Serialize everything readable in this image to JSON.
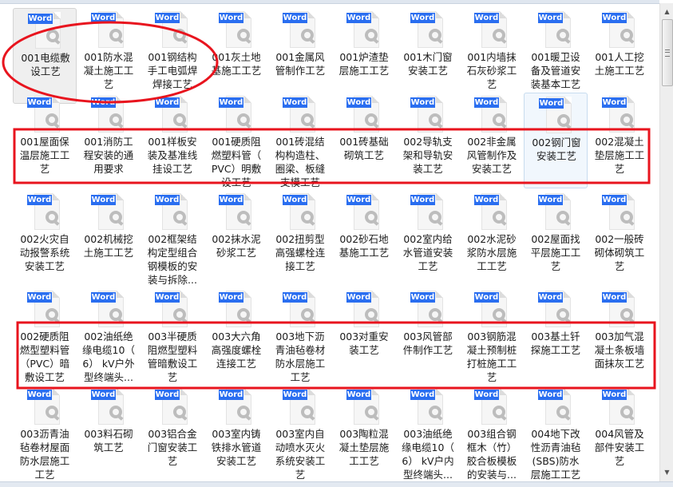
{
  "badge_label": "Word",
  "icon": "wps-word-document-icon",
  "colors": {
    "badge": "#2a6ef0",
    "annotation": "#e8141e",
    "selected": "#efefef",
    "hover": "#f1f7fd"
  },
  "files": [
    {
      "name": "001电缆敷设工艺",
      "state": "selected"
    },
    {
      "name": "001防水混凝土施工工艺"
    },
    {
      "name": "001钢结构手工电弧焊焊接工艺"
    },
    {
      "name": "001灰土地基施工工艺"
    },
    {
      "name": "001金属风管制作工艺"
    },
    {
      "name": "001炉渣垫层施工工艺"
    },
    {
      "name": "001木门窗安装工艺"
    },
    {
      "name": "001内墙抹石灰砂浆工艺"
    },
    {
      "name": "001暖卫设备及管道安装基本工艺"
    },
    {
      "name": "001人工挖土施工工艺"
    },
    {
      "name": "001屋面保温层施工工艺"
    },
    {
      "name": "001消防工程安装的通用要求"
    },
    {
      "name": "001样板安装及基准线挂设工艺"
    },
    {
      "name": "001硬质阻燃塑料管（PVC）明敷设工艺"
    },
    {
      "name": "001砖混结构构造柱、圈梁、板缝支模工艺"
    },
    {
      "name": "001砖基础砌筑工艺"
    },
    {
      "name": "002导轨支架和导轨安装工艺"
    },
    {
      "name": "002非金属风管制作及安装工艺"
    },
    {
      "name": "002钢门窗安装工艺",
      "state": "hover"
    },
    {
      "name": "002混凝土垫层施工工艺"
    },
    {
      "name": "002火灾自动报警系统安装工艺"
    },
    {
      "name": "002机械挖土施工工艺"
    },
    {
      "name": "002框架结构定型组合钢模板的安装与拆除..."
    },
    {
      "name": "002抹水泥砂浆工艺"
    },
    {
      "name": "002扭剪型高强螺栓连接工艺"
    },
    {
      "name": "002砂石地基施工工艺"
    },
    {
      "name": "002室内给水管道安装工艺"
    },
    {
      "name": "002水泥砂浆防水层施工工艺"
    },
    {
      "name": "002屋面找平层施工工艺"
    },
    {
      "name": "002一般砖砌体砌筑工艺"
    },
    {
      "name": "002硬质阻燃型塑料管（PVC）暗敷设工艺"
    },
    {
      "name": "002油纸绝缘电缆10（6） kV户外型终端头..."
    },
    {
      "name": "003半硬质阻燃型塑料管暗敷设工艺"
    },
    {
      "name": "003大六角高强度螺栓连接工艺"
    },
    {
      "name": "003地下沥青油毡卷材防水层施工工艺"
    },
    {
      "name": "003对重安装工艺"
    },
    {
      "name": "003风管部件制作工艺"
    },
    {
      "name": "003钢筋混凝土预制桩打桩施工工艺"
    },
    {
      "name": "003基土钎探施工工艺"
    },
    {
      "name": "003加气混凝土条板墙面抹灰工艺"
    },
    {
      "name": "003沥青油毡卷材屋面防水层施工工艺"
    },
    {
      "name": "003料石砌筑工艺"
    },
    {
      "name": "003铝合金门窗安装工艺"
    },
    {
      "name": "003室内铸铁排水管道安装工艺"
    },
    {
      "name": "003室内自动喷水灭火系统安装工艺"
    },
    {
      "name": "003陶粒混凝土垫层施工工艺"
    },
    {
      "name": "003油纸绝缘电缆10（6） kV户内型终端头..."
    },
    {
      "name": "003组合钢框木（竹）胶合板模板的安装与..."
    },
    {
      "name": "004地下改性沥青油毡(SBS)防水层施工工艺"
    },
    {
      "name": "004风管及部件安装工艺"
    }
  ]
}
